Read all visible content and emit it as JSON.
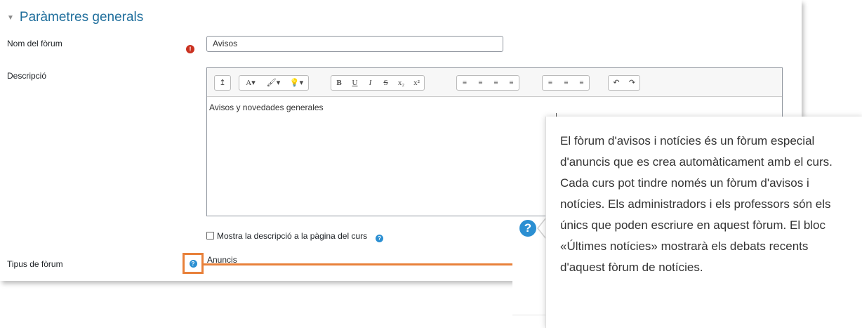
{
  "section": {
    "title": "Paràmetres generals"
  },
  "fields": {
    "name_label": "Nom del fòrum",
    "name_value": "Avisos",
    "description_label": "Descripció",
    "description_value": "Avisos y novedades generales",
    "show_description_label": "Mostra la descripció a la pàgina del curs",
    "forum_type_label": "Tipus de fòrum",
    "forum_type_value": "Anuncis"
  },
  "toolbar": {
    "groups": [
      [
        "↥"
      ],
      [
        "A▾",
        "🖌▾",
        "💡▾"
      ],
      [
        "B",
        "U",
        "I",
        "S",
        "x₂",
        "x²"
      ],
      [
        "≡",
        "≡",
        "≡",
        "≡"
      ],
      [
        "≡",
        "≡",
        "≡"
      ],
      [
        "↶",
        "↷"
      ]
    ]
  },
  "help_popover": {
    "text": "El fòrum d'avisos i notícies és un fòrum especial d'anuncis que es crea automàticament amb el curs. Cada curs pot tindre només un fòrum d'avisos i notícies. Els administradors i els professors són els únics que poden escriure en aquest fòrum. El bloc «Últimes notícies» mostrarà els debats recents d'aquest fòrum de notícies."
  },
  "colors": {
    "accent": "#1f6e9c",
    "required": "#ca3120",
    "help": "#2b8fd2",
    "highlight": "#e8803a"
  },
  "icons": {
    "required": "!",
    "help": "?"
  }
}
